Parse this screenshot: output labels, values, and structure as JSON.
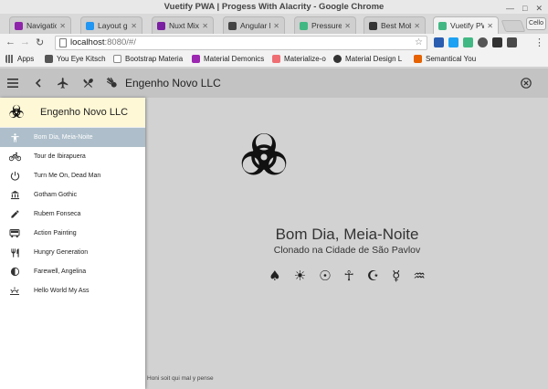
{
  "window": {
    "title": "Vuetify PWA | Progess With Alacrity - Google Chrome"
  },
  "tabs": [
    {
      "label": "Navigation",
      "color": "#8e24aa"
    },
    {
      "label": "Layout grid",
      "color": "#2196f3"
    },
    {
      "label": "Nuxt Mixed",
      "color": "#7b1fa2"
    },
    {
      "label": "Angular Bar",
      "color": "#444444"
    },
    {
      "label": "Pressure W",
      "color": "#41b883"
    },
    {
      "label": "Best Mobile",
      "color": "#333333"
    },
    {
      "label": "Vuetify PWA",
      "color": "#41b883"
    }
  ],
  "profile_label": "Cello",
  "address": {
    "host": "localhost",
    "path": ":8080/#/"
  },
  "bookmarks": [
    {
      "label": "Apps",
      "color": "#666666"
    },
    {
      "label": "You Eye Kitsch",
      "color": "#555555"
    },
    {
      "label": "Bootstrap Materia",
      "color": "#888888"
    },
    {
      "label": "Material Demonics",
      "color": "#9c27b0"
    },
    {
      "label": "Materialize-o",
      "color": "#ee6e73"
    },
    {
      "label": "Material Design L",
      "color": "#333333"
    },
    {
      "label": "Semantical You",
      "color": "#e66100"
    }
  ],
  "appbar": {
    "title": "Engenho Novo LLC"
  },
  "drawer": {
    "title": "Engenho Novo LLC",
    "items": [
      {
        "label": "Bom Dia, Meia-Noite",
        "icon": "person-standing-icon",
        "active": true
      },
      {
        "label": "Tour de Ibirapuera",
        "icon": "bike-icon",
        "active": false
      },
      {
        "label": "Turn Me On, Dead Man",
        "icon": "power-icon",
        "active": false
      },
      {
        "label": "Gotham Gothic",
        "icon": "bank-icon",
        "active": false
      },
      {
        "label": "Rubem Fonseca",
        "icon": "pencil-icon",
        "active": false
      },
      {
        "label": "Action Painting",
        "icon": "bus-icon",
        "active": false
      },
      {
        "label": "Hungry Generation",
        "icon": "restaurant-icon",
        "active": false
      },
      {
        "label": "Farewell, Angelina",
        "icon": "contrast-icon",
        "active": false
      },
      {
        "label": "Hello World My Ass",
        "icon": "sunrise-icon",
        "active": false
      }
    ]
  },
  "hero": {
    "heading": "Bom Dia, Meia-Noite",
    "subheading": "Clonado na Cidade de São Pavlov",
    "symbols": [
      "♠",
      "☀",
      "☉",
      "☥",
      "☪",
      "☿",
      "♒"
    ]
  },
  "footer": {
    "text": "Honi soit qui mal y pense"
  }
}
